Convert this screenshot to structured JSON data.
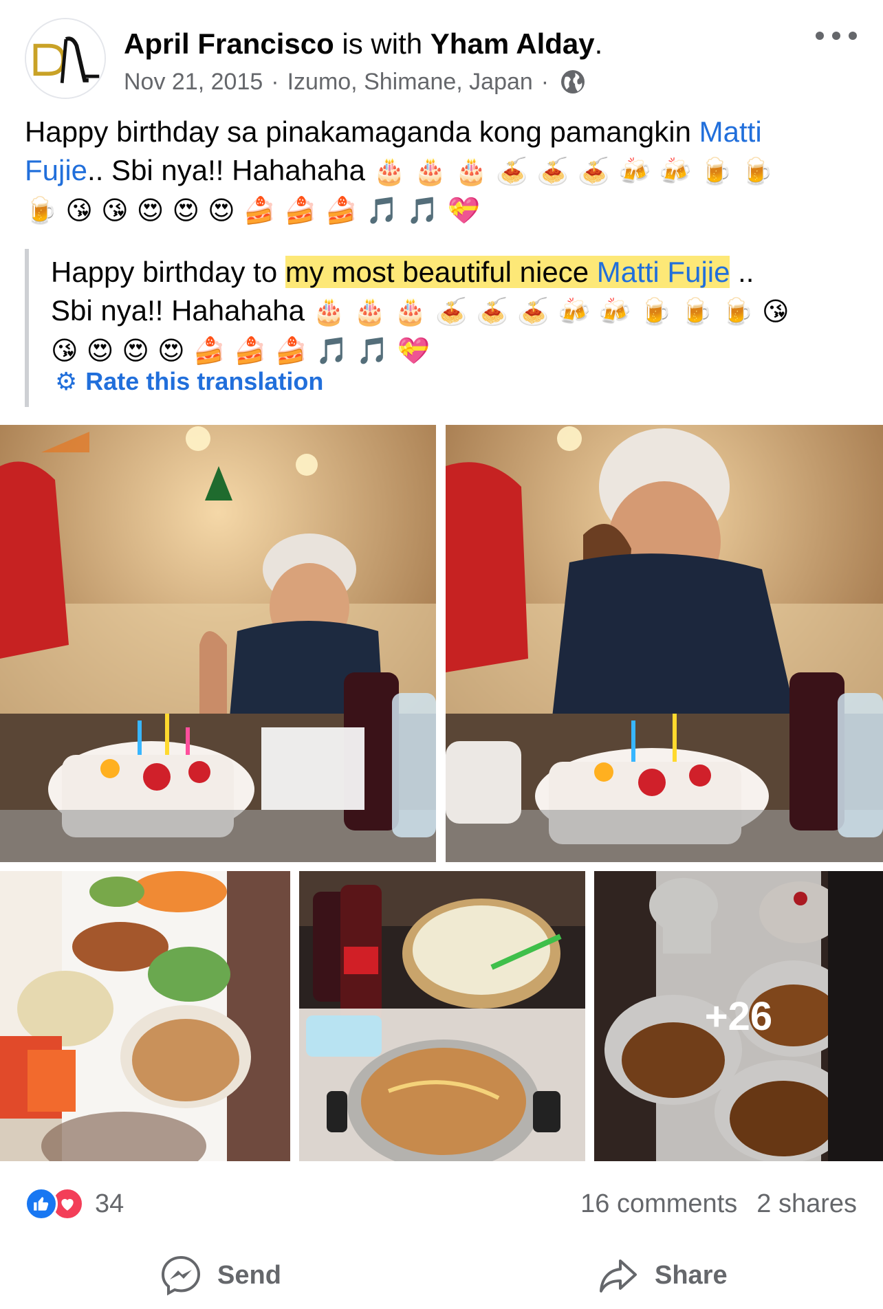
{
  "post": {
    "author": "April Francisco",
    "with_text": " is with ",
    "tagged": "Yham Alday",
    "period": ".",
    "date": "Nov 21, 2015",
    "location": "Izumo, Shimane, Japan",
    "separator": "·",
    "privacy_icon": "globe-icon",
    "more_icon": "more-options-icon"
  },
  "text": {
    "part1": "Happy birthday sa pinakamaganda kong pamangkin ",
    "link1": "Matti",
    "link2": "Fujie",
    "part2": ".. Sbi nya!! Hahahaha ",
    "emoji_line1": "🎂 🎂 🎂 🍝 🍝 🍝 🍻 🍻 🍺 🍺",
    "emoji_line2": "🍺 😘 😘 😍 😍 😍 🍰 🍰 🍰 🎵 🎵 💝"
  },
  "translation": {
    "part1": "Happy birthday to ",
    "highlight": "my most beautiful niece ",
    "link": "Matti Fujie",
    "part2": " ..",
    "part3": "Sbi nya!! Hahahaha ",
    "emoji_line1": "🎂 🎂 🎂 🍝 🍝 🍝 🍻 🍻 🍺 🍺 🍺 😘",
    "emoji_line2": "😘 😍 😍 😍 🍰 🍰 🍰 🎵 🎵 💝",
    "rate_label": "Rate this translation",
    "highlight_color": "#fde877"
  },
  "photos": {
    "more_count": "+26"
  },
  "engagement": {
    "reaction_count": "34",
    "comments": "16 comments",
    "shares": "2 shares",
    "like_color": "#1877f2",
    "love_color": "#f33e58"
  },
  "actions": {
    "send": "Send",
    "share": "Share"
  },
  "colors": {
    "link": "#216fdb",
    "secondary_text": "#65676b"
  }
}
